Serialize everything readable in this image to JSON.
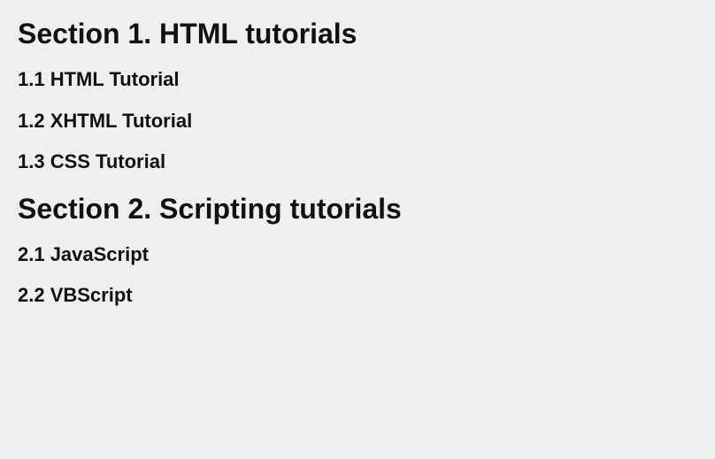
{
  "sections": [
    {
      "title": "Section 1. HTML tutorials",
      "items": [
        "1.1 HTML Tutorial",
        "1.2 XHTML Tutorial",
        "1.3 CSS Tutorial"
      ]
    },
    {
      "title": "Section 2. Scripting tutorials",
      "items": [
        "2.1 JavaScript",
        "2.2 VBScript"
      ]
    }
  ]
}
